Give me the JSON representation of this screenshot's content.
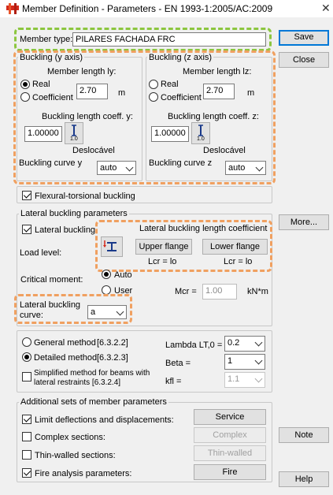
{
  "window": {
    "title": "Member Definition - Parameters - EN 1993-1:2005/AC:2009"
  },
  "member_type": {
    "label": "Member type:",
    "value": "PILARES FACHADA FRC"
  },
  "buckling_y": {
    "group_label": "Buckling (y axis)",
    "length_label": "Member length ly:",
    "real_label": "Real",
    "coefficient_label": "Coefficient",
    "length_value": "2.70",
    "unit": "m",
    "coeff_label": "Buckling length coeff. y:",
    "coeff_value": "1.00000",
    "icon_text": "1.0",
    "mode_label": "Deslocável",
    "curve_label": "Buckling curve y",
    "curve_value": "auto"
  },
  "buckling_z": {
    "group_label": "Buckling (z axis)",
    "length_label": "Member length lz:",
    "real_label": "Real",
    "coefficient_label": "Coefficient",
    "length_value": "2.70",
    "unit": "m",
    "coeff_label": "Buckling length coeff. z:",
    "coeff_value": "1.00000",
    "icon_text": "1.0",
    "mode_label": "Deslocável",
    "curve_label": "Buckling curve z",
    "curve_value": "auto"
  },
  "flexural_torsional": {
    "label": "Flexural-torsional buckling",
    "checked": true
  },
  "lateral": {
    "group_label": "Lateral buckling parameters",
    "lateral_buckling_label": "Lateral buckling",
    "coeff_title": "Lateral buckling length coefficient",
    "load_level_label": "Load level:",
    "upper_flange": "Upper flange",
    "lower_flange": "Lower flange",
    "lcr_upper": "Lcr = lo",
    "lcr_lower": "Lcr = lo",
    "critical_moment_label": "Critical moment:",
    "auto_label": "Auto",
    "user_label": "User",
    "mcr_label": "Mcr =",
    "mcr_value": "1.00",
    "mcr_unit": "kN*m",
    "curve_label_1": "Lateral buckling",
    "curve_label_2": "curve:",
    "curve_value": "a"
  },
  "methods": {
    "general_label": "General method",
    "general_ref": "[6.3.2.2]",
    "detailed_label": "Detailed method",
    "detailed_ref": "[6.3.2.3]",
    "simplified_line1": "Simplified method for beams with",
    "simplified_line2": "lateral restraints [6.3.2.4]",
    "lambda_label": "Lambda LT,0 =",
    "lambda_value": "0.2",
    "beta_label": "Beta =",
    "beta_value": "1",
    "kfl_label": "kfl =",
    "kfl_value": "1.1"
  },
  "additional": {
    "group_label": "Additional sets of member parameters",
    "limit_label": "Limit deflections and displacements:",
    "complex_label": "Complex sections:",
    "thin_label": "Thin-walled sections:",
    "fire_label": "Fire analysis parameters:",
    "service_btn": "Service",
    "complex_btn": "Complex",
    "thin_btn": "Thin-walled",
    "fire_btn": "Fire"
  },
  "buttons": {
    "save": "Save",
    "close": "Close",
    "more": "More...",
    "note": "Note",
    "help": "Help"
  }
}
